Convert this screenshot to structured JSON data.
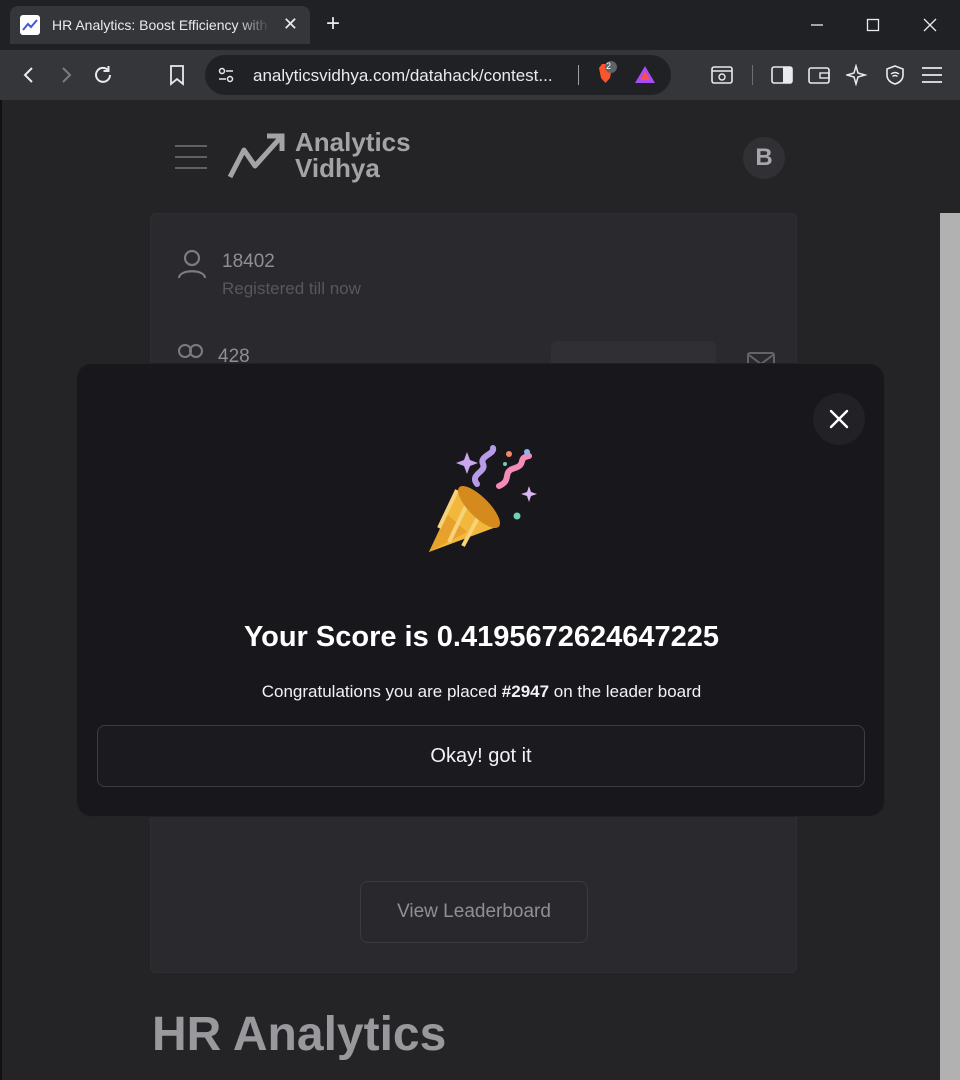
{
  "browser": {
    "tab_title": "HR Analytics: Boost Efficiency with Data",
    "url": "analyticsvidhya.com/datahack/contest...",
    "brave_badge": "2"
  },
  "site": {
    "logo_line1": "Analytics",
    "logo_line2": "Vidhya",
    "avatar_initial": "B"
  },
  "stats": {
    "registered_count": "18402",
    "registered_label": "Registered till now",
    "teams_count": "428"
  },
  "page": {
    "leaderboard_button": "View Leaderboard",
    "heading": "HR Analytics"
  },
  "modal": {
    "score_title": "Your Score is 0.4195672624647225",
    "congrats_prefix": "Congratulations you are placed ",
    "rank": "#2947",
    "congrats_suffix": " on the leader board",
    "okay_button": "Okay! got it"
  },
  "colors": {
    "modal_bg": "#18171b",
    "page_bg": "#2a292d",
    "chrome_bg": "#202124"
  }
}
